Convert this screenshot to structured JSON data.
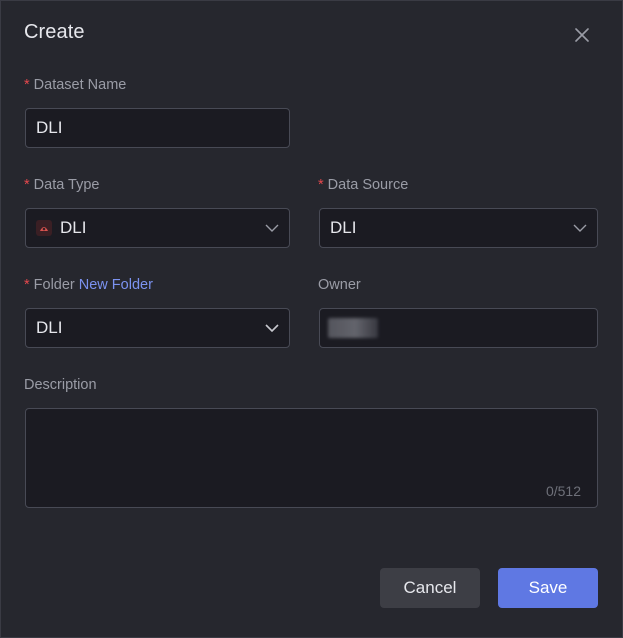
{
  "dialog": {
    "title": "Create",
    "close_icon": "close-icon"
  },
  "form": {
    "dataset_name": {
      "required_mark": "*",
      "label": "Dataset Name",
      "value": "DLI"
    },
    "data_type": {
      "required_mark": "*",
      "label": "Data Type",
      "value": "DLI",
      "icon": "dli-icon"
    },
    "data_source": {
      "required_mark": "*",
      "label": "Data Source",
      "value": "DLI"
    },
    "folder": {
      "required_mark": "*",
      "label": "Folder",
      "link": "New Folder",
      "value": "DLI"
    },
    "owner": {
      "label": "Owner"
    },
    "description": {
      "label": "Description",
      "value": "",
      "counter": "0/512"
    }
  },
  "footer": {
    "cancel_label": "Cancel",
    "save_label": "Save"
  },
  "colors": {
    "background": "#26272e",
    "field_bg": "#1b1b22",
    "accent": "#5f78e3",
    "required": "#e5484d",
    "link": "#7b92f0"
  }
}
